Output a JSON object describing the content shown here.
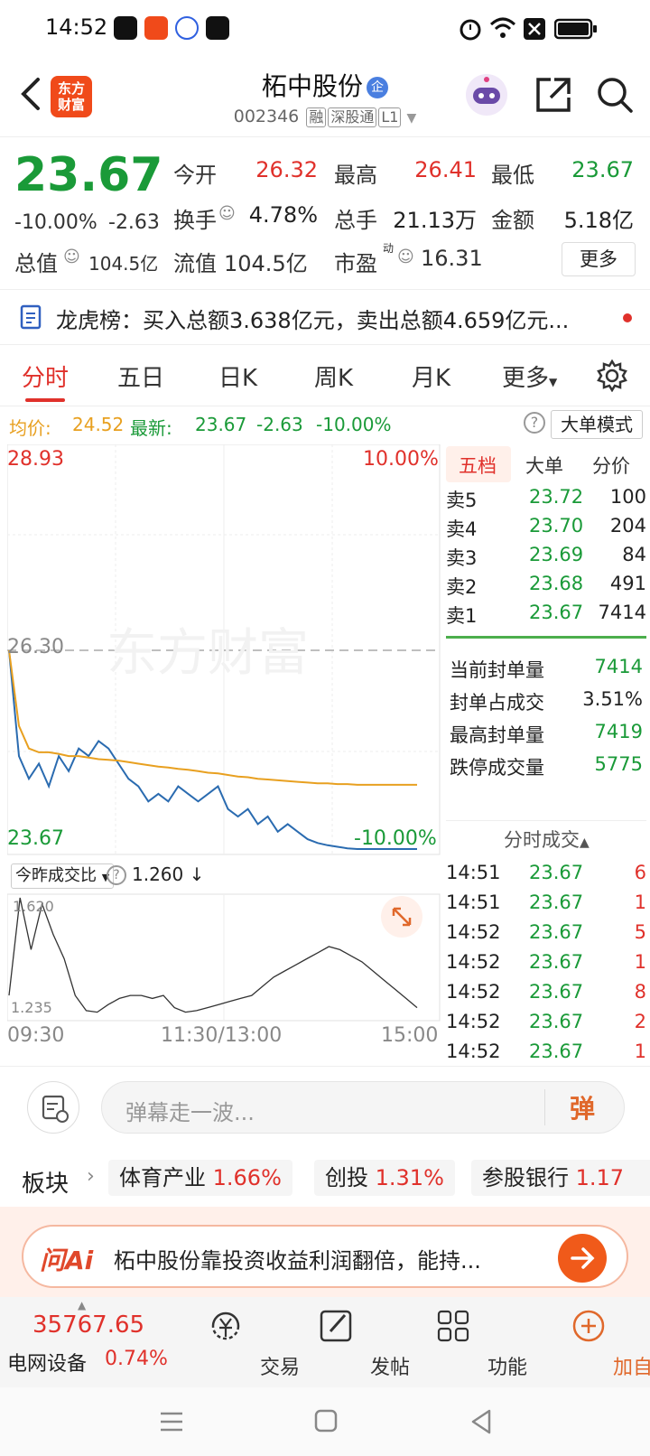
{
  "status": {
    "time": "14:52"
  },
  "header": {
    "name": "柘中股份",
    "badge": "企",
    "code": "002346",
    "tags": [
      "融",
      "深股通",
      "L1"
    ],
    "logo_text_line1": "东方",
    "logo_text_line2": "财富"
  },
  "quote": {
    "price": "23.67",
    "change_pct": "-10.00%",
    "change": "-2.63",
    "open_label": "今开",
    "open": "26.32",
    "high_label": "最高",
    "high": "26.41",
    "low_label": "最低",
    "low": "23.67",
    "turnover_label": "换手",
    "turnover": "4.78%",
    "volume_label": "总手",
    "volume": "21.13万",
    "amount_label": "金额",
    "amount": "5.18亿",
    "mktcap_label": "总值",
    "mktcap": "104.5亿",
    "float_label": "流值",
    "float": "104.5亿",
    "pe_label": "市盈",
    "pe_sup": "动",
    "pe": "16.31",
    "more_label": "更多"
  },
  "lhb": {
    "text": "龙虎榜：买入总额3.638亿元，卖出总额4.659亿元..."
  },
  "tabs": [
    "分时",
    "五日",
    "日K",
    "周K",
    "月K",
    "更多"
  ],
  "avgrow": {
    "avg_label": "均价:",
    "avg": "24.52",
    "latest_label": "最新:",
    "latest": "23.67",
    "latest_chg": "-2.63",
    "latest_pct": "-10.00%",
    "mode_label": "大单模式"
  },
  "chart_labels": {
    "top_price": "28.93",
    "top_pct": "10.00%",
    "mid_price": "26.30",
    "bot_price": "23.67",
    "bot_pct": "-10.00%",
    "watermark": "东方财富",
    "ratio_label": "今昨成交比",
    "ratio_value": "1.260",
    "vol_top": "1.620",
    "vol_bot": "1.235",
    "t_start": "09:30",
    "t_mid": "11:30/13:00",
    "t_end": "15:00"
  },
  "chart_data": {
    "type": "line",
    "x_range": [
      "09:30",
      "15:00"
    ],
    "ylim": [
      23.67,
      28.93
    ],
    "reference": 26.3,
    "series": [
      {
        "values": [
          26.3,
          24.9,
          24.6,
          24.8,
          24.5,
          24.9,
          24.7,
          25.0,
          24.9,
          25.1,
          25.0,
          24.8,
          24.6,
          24.5,
          24.3,
          24.4,
          24.3,
          24.5,
          24.4,
          24.3,
          24.4,
          24.5,
          24.2,
          24.1,
          24.2,
          24.0,
          24.1,
          23.9,
          24.0,
          23.9,
          23.8,
          23.75,
          23.72,
          23.7,
          23.68,
          23.67,
          23.67,
          23.67,
          23.67,
          23.67,
          23.67,
          23.67
        ]
      },
      {
        "values": [
          26.3,
          25.3,
          25.0,
          24.95,
          24.95,
          24.93,
          24.9,
          24.9,
          24.88,
          24.86,
          24.85,
          24.84,
          24.82,
          24.8,
          24.78,
          24.76,
          24.75,
          24.73,
          24.72,
          24.7,
          24.68,
          24.67,
          24.65,
          24.63,
          24.62,
          24.6,
          24.59,
          24.58,
          24.57,
          24.56,
          24.55,
          24.54,
          24.54,
          24.53,
          24.53,
          24.52,
          24.52,
          24.52,
          24.52,
          24.52,
          24.52,
          24.52
        ]
      }
    ],
    "ratio_range": [
      1.235,
      1.62
    ],
    "ratio_values": [
      1.3,
      1.62,
      1.45,
      1.6,
      1.5,
      1.42,
      1.3,
      1.25,
      1.245,
      1.27,
      1.29,
      1.3,
      1.3,
      1.29,
      1.3,
      1.26,
      1.245,
      1.25,
      1.26,
      1.27,
      1.28,
      1.29,
      1.3,
      1.33,
      1.36,
      1.38,
      1.4,
      1.42,
      1.44,
      1.46,
      1.45,
      1.43,
      1.41,
      1.38,
      1.35,
      1.32,
      1.29,
      1.26
    ]
  },
  "orderbook": {
    "tabs": [
      "五档",
      "大单",
      "分价"
    ],
    "asks": [
      {
        "label": "卖5",
        "price": "23.72",
        "vol": "100"
      },
      {
        "label": "卖4",
        "price": "23.70",
        "vol": "204"
      },
      {
        "label": "卖3",
        "price": "23.69",
        "vol": "84"
      },
      {
        "label": "卖2",
        "price": "23.68",
        "vol": "491"
      },
      {
        "label": "卖1",
        "price": "23.67",
        "vol": "7414"
      }
    ],
    "stats": [
      {
        "label": "当前封单量",
        "value": "7414"
      },
      {
        "label": "封单占成交",
        "value": "3.51%"
      },
      {
        "label": "最高封单量",
        "value": "7419"
      },
      {
        "label": "跌停成交量",
        "value": "5775"
      }
    ],
    "trades_title": "分时成交",
    "trades": [
      {
        "time": "14:51",
        "price": "23.67",
        "vol": "6"
      },
      {
        "time": "14:51",
        "price": "23.67",
        "vol": "1"
      },
      {
        "time": "14:52",
        "price": "23.67",
        "vol": "5"
      },
      {
        "time": "14:52",
        "price": "23.67",
        "vol": "1"
      },
      {
        "time": "14:52",
        "price": "23.67",
        "vol": "8"
      },
      {
        "time": "14:52",
        "price": "23.67",
        "vol": "2"
      },
      {
        "time": "14:52",
        "price": "23.67",
        "vol": "1"
      }
    ]
  },
  "danmu": {
    "placeholder": "弹幕走一波...",
    "btn": "弹"
  },
  "sectors": {
    "label": "板块",
    "items": [
      {
        "name": "体育产业",
        "pct": "1.66%"
      },
      {
        "name": "创投",
        "pct": "1.31%"
      },
      {
        "name": "参股银行",
        "pct": "1.17"
      }
    ]
  },
  "ai": {
    "logo": "问Ai",
    "text": "柘中股份靠投资收益利润翻倍，能持..."
  },
  "nav": {
    "index_value": "35767.65",
    "index_name": "电网设备",
    "index_pct": "0.74%",
    "items": [
      "交易",
      "发帖",
      "功能",
      "加自选"
    ]
  }
}
